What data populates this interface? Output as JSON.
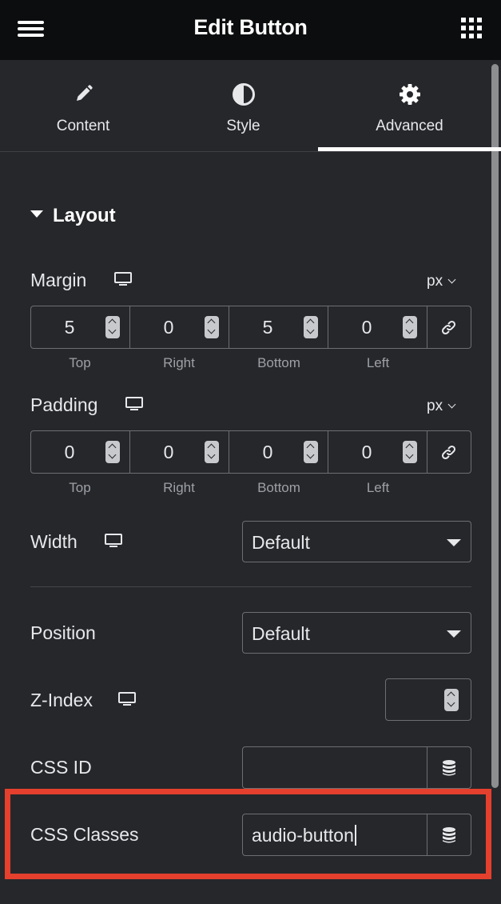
{
  "header": {
    "title": "Edit Button",
    "menu_icon": "hamburger-icon",
    "apps_icon": "grid-icon"
  },
  "tabs": [
    {
      "label": "Content",
      "icon": "pencil-icon",
      "active": false
    },
    {
      "label": "Style",
      "icon": "contrast-icon",
      "active": false
    },
    {
      "label": "Advanced",
      "icon": "gear-icon",
      "active": true
    }
  ],
  "section": {
    "title": "Layout"
  },
  "margin": {
    "label": "Margin",
    "unit": "px",
    "values": [
      "5",
      "0",
      "5",
      "0"
    ],
    "sides": [
      "Top",
      "Right",
      "Bottom",
      "Left"
    ]
  },
  "padding": {
    "label": "Padding",
    "unit": "px",
    "values": [
      "0",
      "0",
      "0",
      "0"
    ],
    "sides": [
      "Top",
      "Right",
      "Bottom",
      "Left"
    ]
  },
  "width": {
    "label": "Width",
    "value": "Default"
  },
  "position": {
    "label": "Position",
    "value": "Default"
  },
  "z_index": {
    "label": "Z-Index",
    "value": ""
  },
  "css_id": {
    "label": "CSS ID",
    "value": ""
  },
  "css_classes": {
    "label": "CSS Classes",
    "value": "audio-button"
  },
  "colors": {
    "header_bg": "#0c0d0e",
    "panel_bg": "#26272b",
    "highlight": "#e4402d"
  }
}
